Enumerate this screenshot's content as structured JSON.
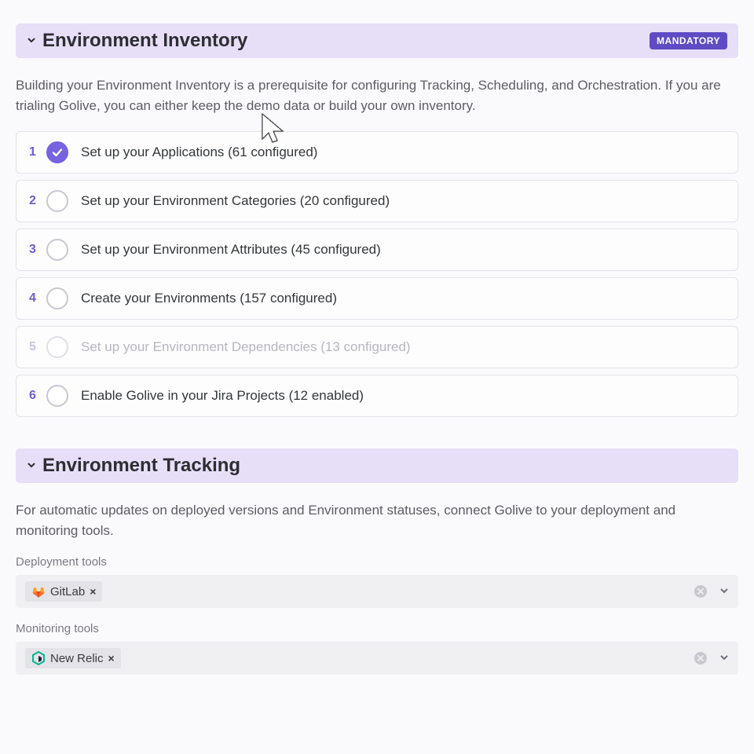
{
  "inventory": {
    "title": "Environment Inventory",
    "badge": "MANDATORY",
    "description": "Building your Environment Inventory is a prerequisite for configuring Tracking, Scheduling, and Orchestration. If you are trialing Golive, you can either keep the demo data or build your own inventory.",
    "steps": [
      {
        "num": "1",
        "label": "Set up your Applications (61 configured)",
        "done": true,
        "muted": false
      },
      {
        "num": "2",
        "label": "Set up your Environment Categories (20 configured)",
        "done": false,
        "muted": false
      },
      {
        "num": "3",
        "label": "Set up your Environment Attributes (45 configured)",
        "done": false,
        "muted": false
      },
      {
        "num": "4",
        "label": "Create your Environments (157 configured)",
        "done": false,
        "muted": false
      },
      {
        "num": "5",
        "label": "Set up your Environment Dependencies (13 configured)",
        "done": false,
        "muted": true
      },
      {
        "num": "6",
        "label": "Enable Golive in your Jira Projects (12 enabled)",
        "done": false,
        "muted": false
      }
    ]
  },
  "tracking": {
    "title": "Environment Tracking",
    "description": "For automatic updates on deployed versions and Environment statuses, connect Golive to your deployment and monitoring tools.",
    "deployment": {
      "heading": "Deployment tools",
      "chip": {
        "label": "GitLab",
        "icon": "gitlab-icon"
      }
    },
    "monitoring": {
      "heading": "Monitoring tools",
      "chip": {
        "label": "New Relic",
        "icon": "newrelic-icon"
      }
    }
  },
  "glyphs": {
    "x": "×",
    "caret": "⌄"
  }
}
